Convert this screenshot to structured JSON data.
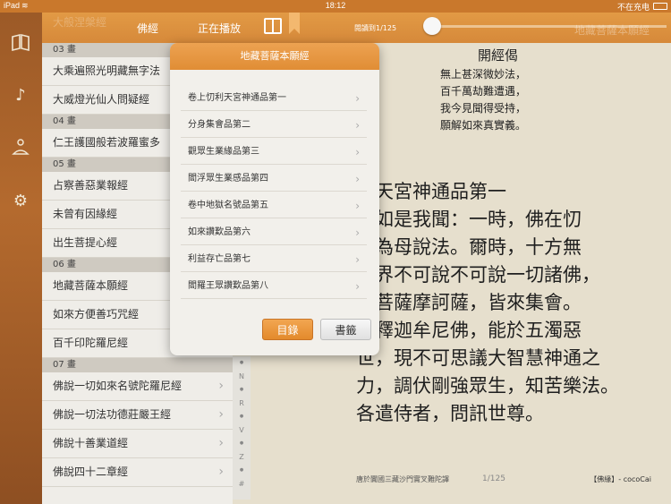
{
  "status_bar": {
    "device": "iPad",
    "wifi": "wifi-icon",
    "time": "18:12",
    "charging": "不在充电",
    "battery": "battery-icon"
  },
  "toolbar": {
    "ghost_title": "大般涅槃經",
    "tab_sutra": "佛經",
    "tab_playing": "正在播放",
    "progress_label": "閱讀到1/125",
    "ghost_right": "地藏菩薩本願經",
    "progress": 0.0
  },
  "rail": {
    "icons": [
      "book-icon",
      "music-icon",
      "meditation-icon",
      "settings-icon"
    ]
  },
  "list": [
    {
      "type": "section",
      "label": "03 畫"
    },
    {
      "type": "item",
      "label": "大乘遍照光明藏無字法"
    },
    {
      "type": "item",
      "label": "大威燈光仙人問疑經"
    },
    {
      "type": "section",
      "label": "04 畫"
    },
    {
      "type": "item",
      "label": "仁王護國般若波羅蜜多"
    },
    {
      "type": "section",
      "label": "05 畫"
    },
    {
      "type": "item",
      "label": "占察善惡業報經"
    },
    {
      "type": "item",
      "label": "未曾有因緣經"
    },
    {
      "type": "item",
      "label": "出生菩提心經"
    },
    {
      "type": "section",
      "label": "06 畫"
    },
    {
      "type": "item",
      "label": "地藏菩薩本願經"
    },
    {
      "type": "item",
      "label": "如來方便善巧咒經"
    },
    {
      "type": "item",
      "label": "百千印陀羅尼經"
    },
    {
      "type": "section",
      "label": "07 畫"
    },
    {
      "type": "item",
      "label": "佛說一切如來名號陀羅尼經"
    },
    {
      "type": "item",
      "label": "佛說一切法功德莊嚴王經"
    },
    {
      "type": "item",
      "label": "佛說十善業道經"
    },
    {
      "type": "item",
      "label": "佛說四十二章經"
    }
  ],
  "index_letters": [
    "N",
    "R",
    "V",
    "Z",
    "#"
  ],
  "popover": {
    "title": "地藏菩薩本願經",
    "chapters": [
      "卷上忉利天宮神通品第一",
      "分身集會品第二",
      "觀眾生業緣品第三",
      "閻浮眾生業感品第四",
      "卷中地獄名號品第五",
      "如來讚歎品第六",
      "利益存亡品第七",
      "閻羅王眾讚歎品第八"
    ],
    "btn_toc": "目錄",
    "btn_bookmark": "書籤"
  },
  "reader": {
    "verse_title": "開經偈",
    "verse": [
      "無上甚深微妙法，",
      "百千萬劫難遭遇，",
      "我今見聞得受持，",
      "願解如來真實義。"
    ],
    "body": [
      "利天宮神通品第一",
      "　如是我聞：一時，佛在忉",
      "天為母說法。爾時，十方無",
      "世界不可說不可說一切諸佛，",
      "大菩薩摩訶薩，皆來集會。",
      "嘆釋迦牟尼佛，能於五濁惡",
      "世，現不可思議大智慧神通之",
      "力，調伏剛強眾生，知苦樂法。",
      "各遣侍者，問訊世尊。"
    ],
    "footer_left": "唐於闐國三藏沙門實叉難陀譯",
    "footer_page": "1/125",
    "footer_right": "【佛緣】- cocoCai"
  }
}
